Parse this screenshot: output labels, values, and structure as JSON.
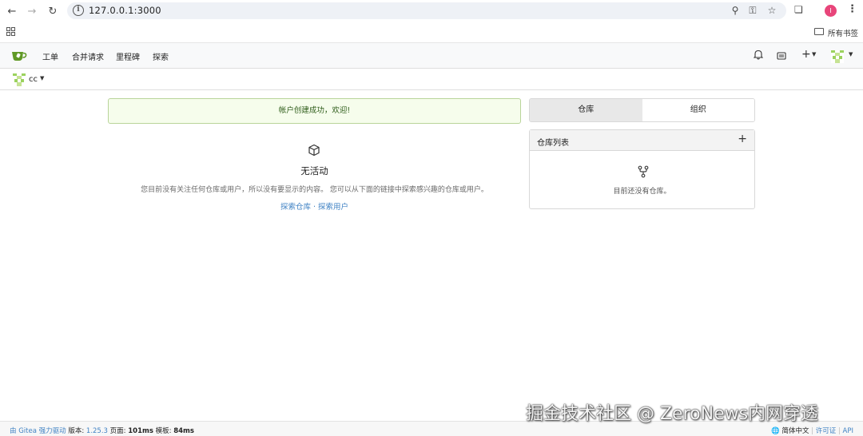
{
  "browser": {
    "url": "127.0.0.1:3000",
    "profile_initial": "I",
    "all_bookmarks": "所有书签"
  },
  "navbar": {
    "items": [
      "工单",
      "合并请求",
      "里程碑",
      "探索"
    ]
  },
  "context": {
    "user": "cc"
  },
  "main": {
    "flash": "帐户创建成功，欢迎!",
    "empty_title": "无活动",
    "empty_desc": "您目前没有关注任何仓库或用户，所以没有要显示的内容。 您可以从下面的链接中探索感兴趣的仓库或用户。",
    "link_repos": "探索仓库",
    "link_sep": " · ",
    "link_users": "探索用户"
  },
  "sidebar": {
    "tabs": [
      "仓库",
      "组织"
    ],
    "repo_list_title": "仓库列表",
    "add_symbol": "+",
    "empty_text": "目前还没有仓库。"
  },
  "footer": {
    "powered_by": "由 Gitea 强力驱动",
    "version_label": "版本:",
    "version": "1.25.3",
    "page_label": "页面:",
    "page_time": "101ms",
    "template_label": "模板:",
    "template_time": "84ms",
    "language": "简体中文",
    "license": "许可证",
    "api": "API"
  },
  "watermark": "掘金技术社区 @ ZeroNews内网穿透",
  "colors": {
    "accent": "#4183c4",
    "flash_bg": "#f6fdec",
    "gitea_green": "#609926"
  }
}
